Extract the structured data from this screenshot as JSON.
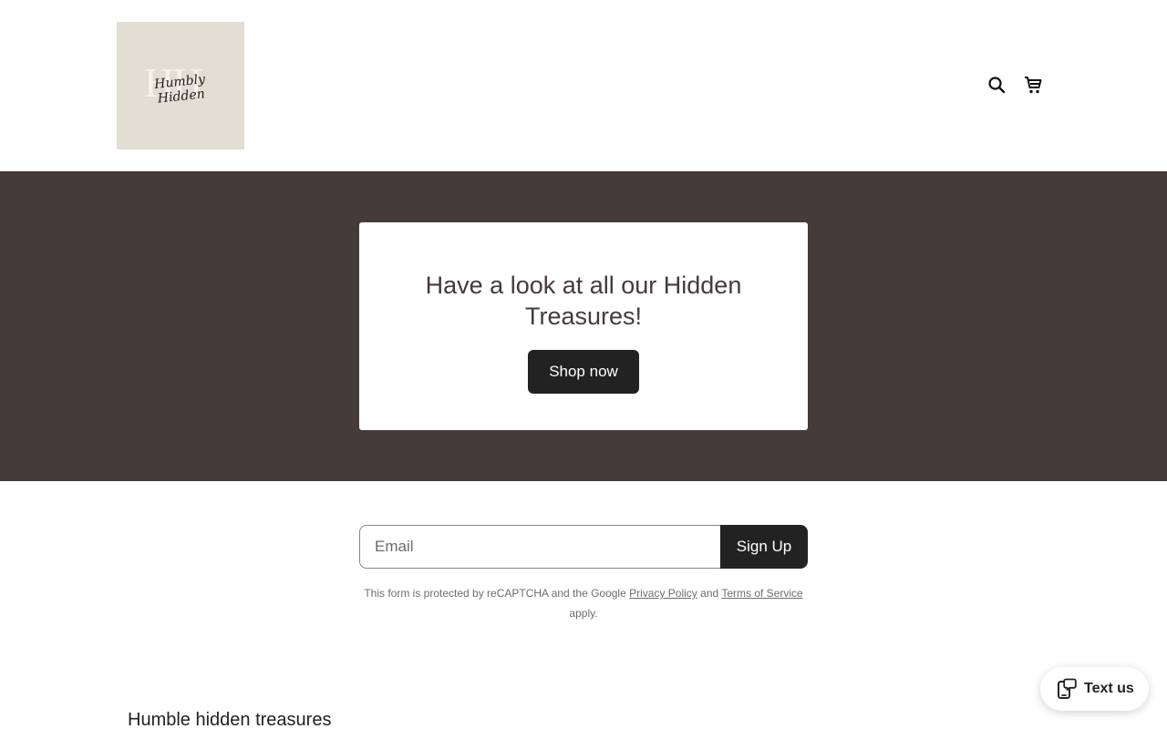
{
  "header": {
    "logo": {
      "monogram": "HH",
      "script_text": "Humbly Hidden"
    },
    "icons": {
      "search": "search-icon",
      "cart": "cart-icon"
    }
  },
  "banner": {
    "heading": "Have a look at all our Hidden Treasures!",
    "button_label": "Shop now",
    "background_color": "#463a3a"
  },
  "newsletter": {
    "email_placeholder": "Email",
    "button_label": "Sign Up",
    "legal": {
      "prefix": "This form is protected by reCAPTCHA and the Google",
      "privacy_link": "Privacy Policy",
      "and": "and",
      "terms_link": "Terms of Service",
      "suffix": "apply."
    }
  },
  "section": {
    "title": "Humble hidden treasures"
  },
  "chat_widget": {
    "label": "Text us",
    "icon": "phone-chat-icon"
  }
}
